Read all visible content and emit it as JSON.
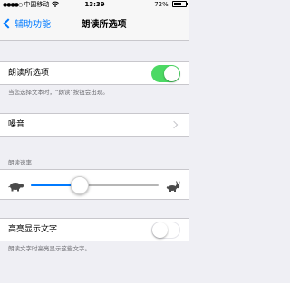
{
  "status_bar": {
    "carrier": "中国移动",
    "network": "",
    "time": "13:39",
    "battery": "72%",
    "battery_level": 0.72
  },
  "nav": {
    "back_label": "辅助功能",
    "title": "朗读所选项"
  },
  "speak_selection": {
    "label": "朗读所选项",
    "enabled": true,
    "footer": "当您选择文本时，“朗读”按钮会出现。"
  },
  "voices": {
    "label": "嗓音"
  },
  "speaking_rate": {
    "header": "朗读速率",
    "value": 0.38,
    "slow_icon": "turtle-icon",
    "fast_icon": "rabbit-icon"
  },
  "highlight_words": {
    "label": "高亮显示文字",
    "enabled": false,
    "footer": "朗读文字时高亮显示这些文字。"
  },
  "colors": {
    "accent": "#007aff",
    "switch_on": "#4cd964",
    "background": "#efeff4"
  }
}
